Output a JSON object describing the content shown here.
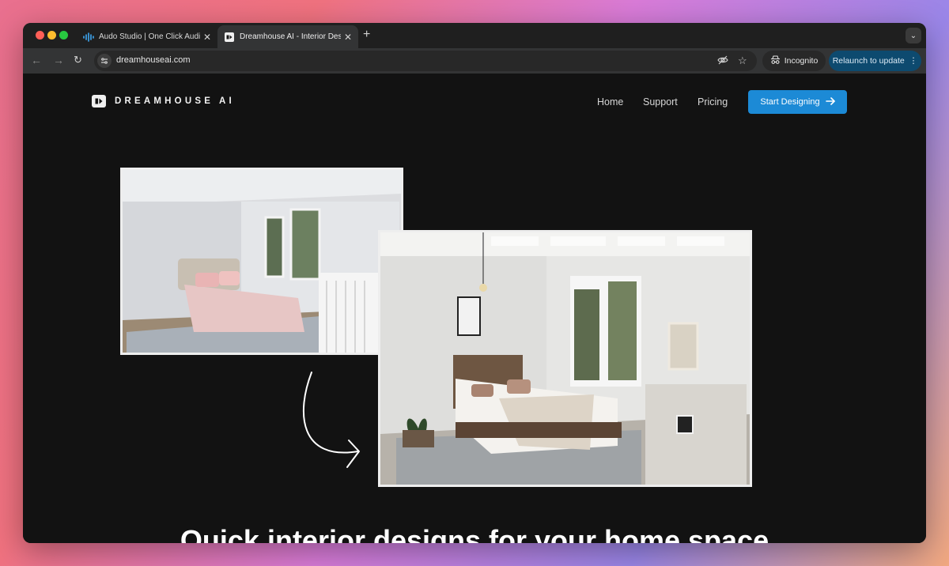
{
  "browser": {
    "tabs": [
      {
        "title": "Audo Studio | One Click Audio",
        "favicon": "audio-waveform-icon",
        "active": false
      },
      {
        "title": "Dreamhouse AI - Interior Design",
        "favicon": "dreamhouse-logo-icon",
        "active": true
      }
    ],
    "url": "dreamhouseai.com",
    "incognito_label": "Incognito",
    "relaunch_label": "Relaunch to update"
  },
  "site": {
    "brand": "DREAMHOUSE AI",
    "nav": [
      "Home",
      "Support",
      "Pricing"
    ],
    "cta_label": "Start Designing",
    "headline": "Quick interior designs for your home space"
  },
  "colors": {
    "page_bg": "#121212",
    "cta_bg": "#1c8ad6",
    "relaunch_bg": "#0d4a6f"
  }
}
